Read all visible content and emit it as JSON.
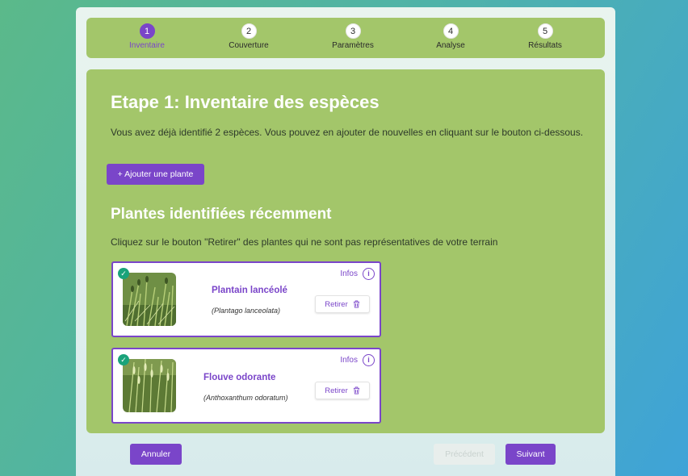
{
  "stepper": {
    "steps": [
      {
        "num": "1",
        "label": "Inventaire"
      },
      {
        "num": "2",
        "label": "Couverture"
      },
      {
        "num": "3",
        "label": "Paramètres"
      },
      {
        "num": "4",
        "label": "Analyse"
      },
      {
        "num": "5",
        "label": "Résultats"
      }
    ],
    "active_index": 0
  },
  "main": {
    "title": "Etape 1: Inventaire des espèces",
    "subtitle": "Vous avez déjà identifié 2 espèces. Vous pouvez en ajouter de nouvelles en cliquant sur le bouton ci-dessous.",
    "add_button": "+ Ajouter une plante",
    "section_title": "Plantes identifiées récemment",
    "section_subtitle": "Cliquez sur le bouton \"Retirer\" des plantes qui ne sont pas représentatives de votre terrain"
  },
  "plants": [
    {
      "name": "Plantain lancéolé",
      "latin": "(Plantago lanceolata)",
      "infos": "Infos",
      "remove": "Retirer",
      "selected": true,
      "icon": "check-icon"
    },
    {
      "name": "Flouve odorante",
      "latin": "(Anthoxanthum odoratum)",
      "infos": "Infos",
      "remove": "Retirer",
      "selected": true,
      "icon": "check-icon"
    }
  ],
  "footer": {
    "cancel": "Annuler",
    "previous": "Précédent",
    "next": "Suivant"
  },
  "colors": {
    "accent": "#7a45c9",
    "panel_green": "#a3c66a",
    "check_green": "#1aa37a"
  }
}
